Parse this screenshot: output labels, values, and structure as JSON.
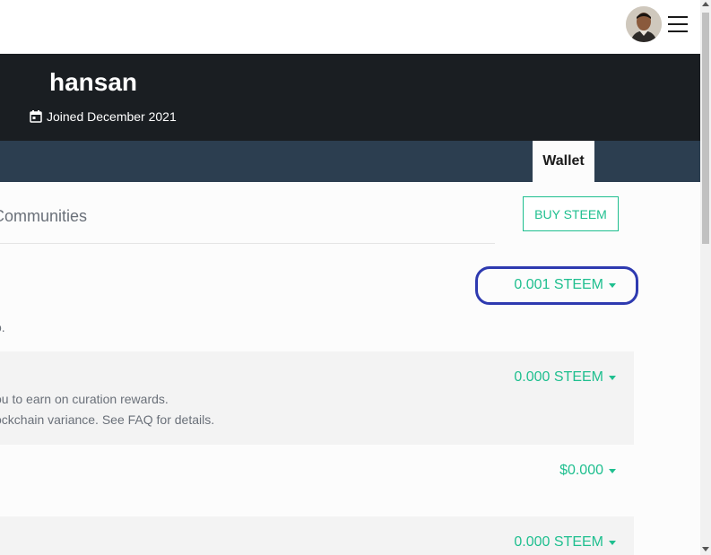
{
  "header": {
    "avatar_icon": "user-avatar",
    "menu_icon": "hamburger-menu-icon"
  },
  "profile": {
    "username": "hansan",
    "joined": "Joined December 2021",
    "calendar_icon": "calendar-icon"
  },
  "tabs": {
    "wallet": "Wallet"
  },
  "content": {
    "communities": "Communities",
    "buy_button": "BUY STEEM",
    "rows": [
      {
        "value": "0.001 STEEM",
        "desc": [
          "o."
        ]
      },
      {
        "value": "0.000 STEEM",
        "desc": [
          "ou to earn on curation rewards.",
          "ockchain variance. See FAQ for details."
        ]
      },
      {
        "value": "$0.000",
        "desc": []
      },
      {
        "value": "0.000 STEEM",
        "desc": []
      }
    ]
  },
  "colors": {
    "accent": "#1fbf8f",
    "header_bg": "#1a1e22",
    "tab_bg": "#2c3e50",
    "annotation": "#2e3ab0"
  }
}
